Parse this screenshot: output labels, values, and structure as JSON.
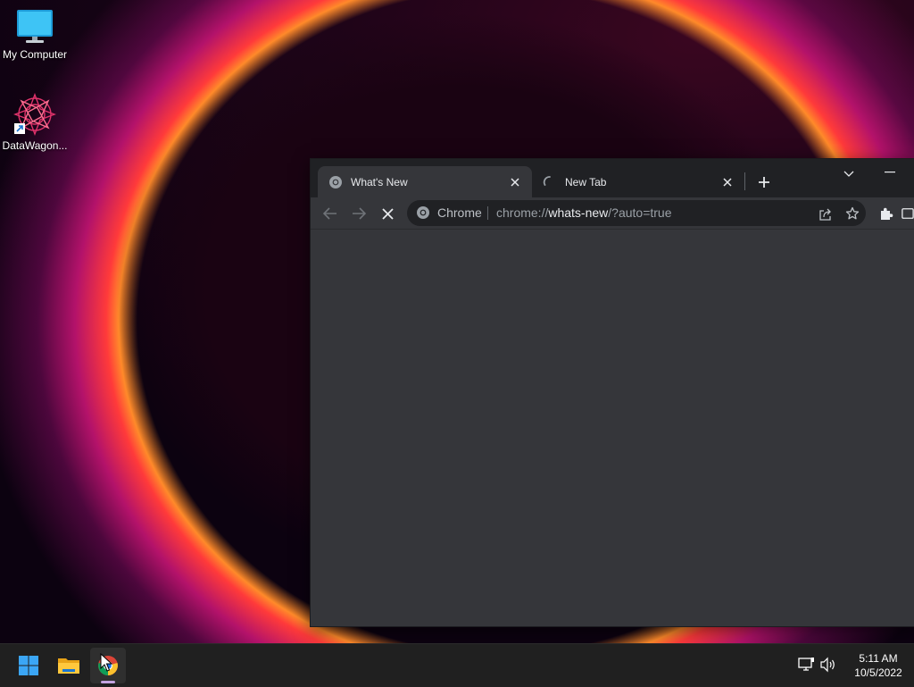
{
  "desktop": {
    "icons": [
      {
        "label": "My Computer"
      },
      {
        "label": "DataWagon..."
      }
    ]
  },
  "browser": {
    "tabs": [
      {
        "title": "What's New",
        "active": true
      },
      {
        "title": "New Tab",
        "active": false
      }
    ],
    "omnibox": {
      "chip_label": "Chrome",
      "url_scheme": "chrome://",
      "url_host": "whats-new",
      "url_rest": "/?auto=true"
    }
  },
  "taskbar": {
    "clock_time": "5:11 AM",
    "clock_date": "10/5/2022"
  },
  "colors": {
    "browser_frame": "#202124",
    "browser_toolbar": "#35363a",
    "taskbar": "#202020",
    "accent_windows": "#3ba6f5"
  }
}
